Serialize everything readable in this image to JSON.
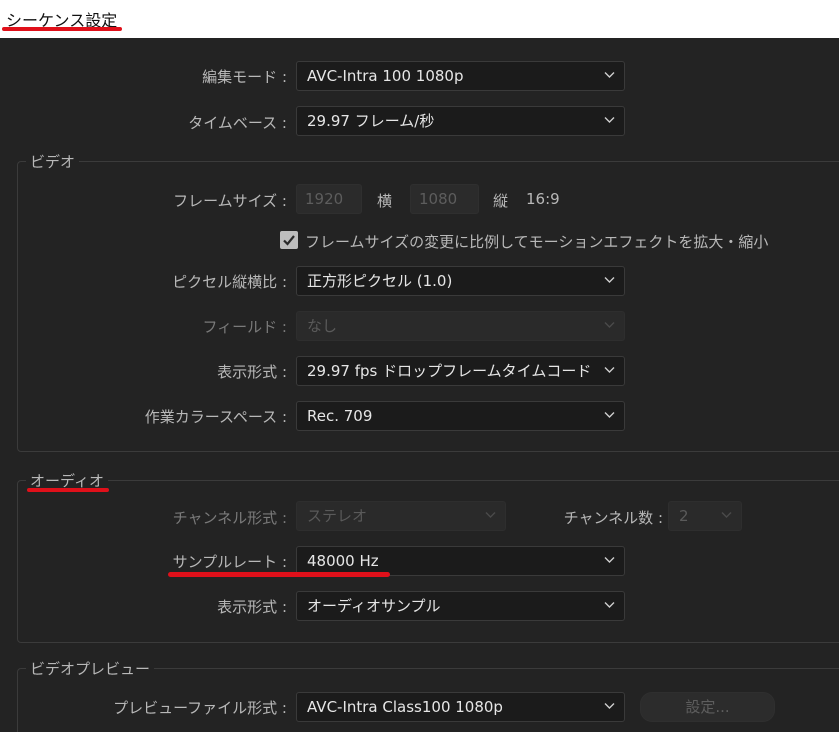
{
  "window": {
    "title": "シーケンス設定"
  },
  "top": {
    "edit_mode": {
      "label": "編集モード :",
      "value": "AVC-Intra 100 1080p"
    },
    "timebase": {
      "label": "タイムベース :",
      "value": "29.97  フレーム/秒"
    }
  },
  "video": {
    "legend": "ビデオ",
    "frame_size": {
      "label": "フレームサイズ :",
      "width": "1920",
      "width_label": "横",
      "height": "1080",
      "height_label": "縦",
      "aspect": "16:9"
    },
    "scale_checkbox": {
      "checked": true,
      "label": "フレームサイズの変更に比例してモーションエフェクトを拡大・縮小"
    },
    "pixel_aspect": {
      "label": "ピクセル縦横比 :",
      "value": "正方形ピクセル (1.0)"
    },
    "fields": {
      "label": "フィールド :",
      "value": "なし"
    },
    "display_format": {
      "label": "表示形式 :",
      "value": "29.97 fps ドロップフレームタイムコード"
    },
    "color_space": {
      "label": "作業カラースペース :",
      "value": "Rec. 709"
    }
  },
  "audio": {
    "legend": "オーディオ",
    "channel_format": {
      "label": "チャンネル形式 :",
      "value": "ステレオ"
    },
    "channel_count": {
      "label": "チャンネル数 :",
      "value": "2"
    },
    "sample_rate": {
      "label": "サンプルレート :",
      "value": "48000 Hz"
    },
    "display_format": {
      "label": "表示形式 :",
      "value": "オーディオサンプル"
    }
  },
  "video_preview": {
    "legend": "ビデオプレビュー",
    "file_format": {
      "label": "プレビューファイル形式 :",
      "value": "AVC-Intra Class100 1080p"
    },
    "settings_button": "設定..."
  },
  "colors": {
    "annotation_red": "#e0101a",
    "background": "#232323",
    "title_bar": "#ffffff"
  },
  "icons": {
    "dropdown": "chevron-down-icon",
    "checkbox": "checkmark-icon"
  }
}
